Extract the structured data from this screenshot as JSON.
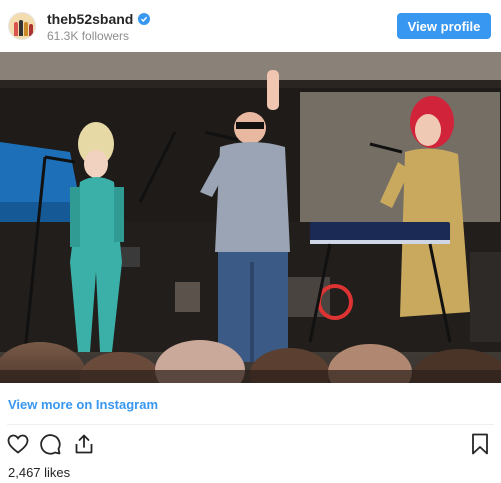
{
  "header": {
    "username": "theb52sband",
    "followers": "61.3K followers",
    "view_profile_label": "View profile",
    "verified_icon": "verified-badge-icon",
    "accent_color": "#3897f0"
  },
  "footer": {
    "view_more_label": "View more on Instagram",
    "likes": "2,467 likes",
    "icons": [
      "heart-icon",
      "comment-icon",
      "share-icon",
      "bookmark-icon"
    ]
  }
}
